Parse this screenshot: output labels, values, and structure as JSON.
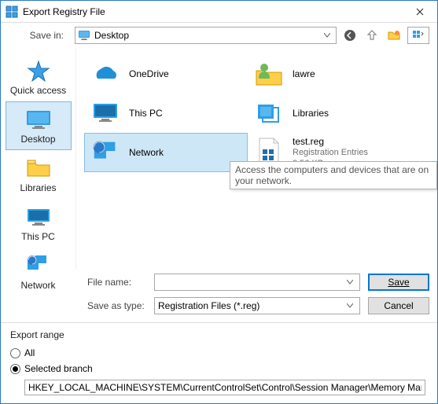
{
  "window": {
    "title": "Export Registry File"
  },
  "toprow": {
    "savein_label": "Save in:",
    "savein_value": "Desktop"
  },
  "sidebar": {
    "items": [
      {
        "label": "Quick access"
      },
      {
        "label": "Desktop"
      },
      {
        "label": "Libraries"
      },
      {
        "label": "This PC"
      },
      {
        "label": "Network"
      }
    ]
  },
  "tiles": {
    "onedrive": "OneDrive",
    "lawre": "lawre",
    "thispc": "This PC",
    "libraries": "Libraries",
    "network": "Network",
    "testreg": {
      "name": "test.reg",
      "type": "Registration Entries",
      "size": "8.56 KB"
    }
  },
  "tooltip": "Access the computers and devices that are on your network.",
  "fields": {
    "filename_label": "File name:",
    "filename_value": "",
    "saveastype_label": "Save as type:",
    "saveastype_value": "Registration Files (*.reg)",
    "save_btn": "Save",
    "cancel_btn": "Cancel"
  },
  "range": {
    "group": "Export range",
    "all": "All",
    "selected": "Selected branch",
    "path": "HKEY_LOCAL_MACHINE\\SYSTEM\\CurrentControlSet\\Control\\Session Manager\\Memory Managemen"
  }
}
